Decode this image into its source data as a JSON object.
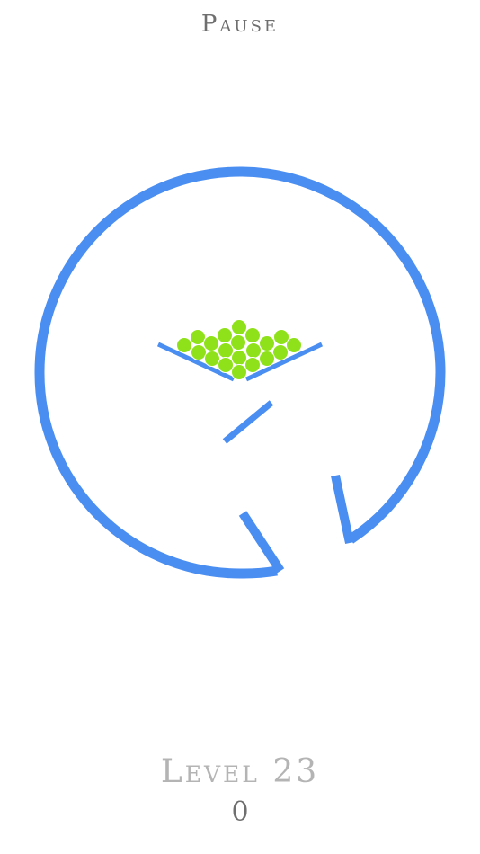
{
  "header": {
    "pause_label": "Pause"
  },
  "footer": {
    "level_label": "Level 23",
    "score": "0"
  },
  "colors": {
    "track": "#4a8ef2",
    "ball": "#8fe21a",
    "ball_outline": "#ffffff",
    "background": "#ffffff"
  },
  "game": {
    "ball_count": 26
  }
}
